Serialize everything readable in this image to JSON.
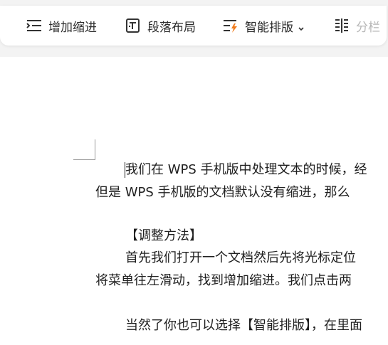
{
  "toolbar": {
    "items": [
      {
        "label": "增加缩进",
        "icon": "indent-increase-icon"
      },
      {
        "label": "段落布局",
        "icon": "paragraph-layout-icon"
      },
      {
        "label": "智能排版",
        "icon": "smart-format-icon"
      },
      {
        "label": "分栏",
        "icon": "columns-icon"
      }
    ]
  },
  "document": {
    "lines": [
      "我们在 WPS 手机版中处理文本的时候，经",
      "但是 WPS 手机版的文档默认没有缩进，那么",
      "【调整方法】",
      "首先我们打开一个文档然后先将光标定位",
      "将菜单往左滑动，找到增加缩进。我们点击两",
      "当然了你也可以选择【智能排版】，在里面"
    ]
  },
  "colors": {
    "accent_orange": "#f07a1a",
    "icon_dark": "#333333",
    "page_bg": "#ffffff",
    "canvas_bg": "#f3f3f3"
  }
}
